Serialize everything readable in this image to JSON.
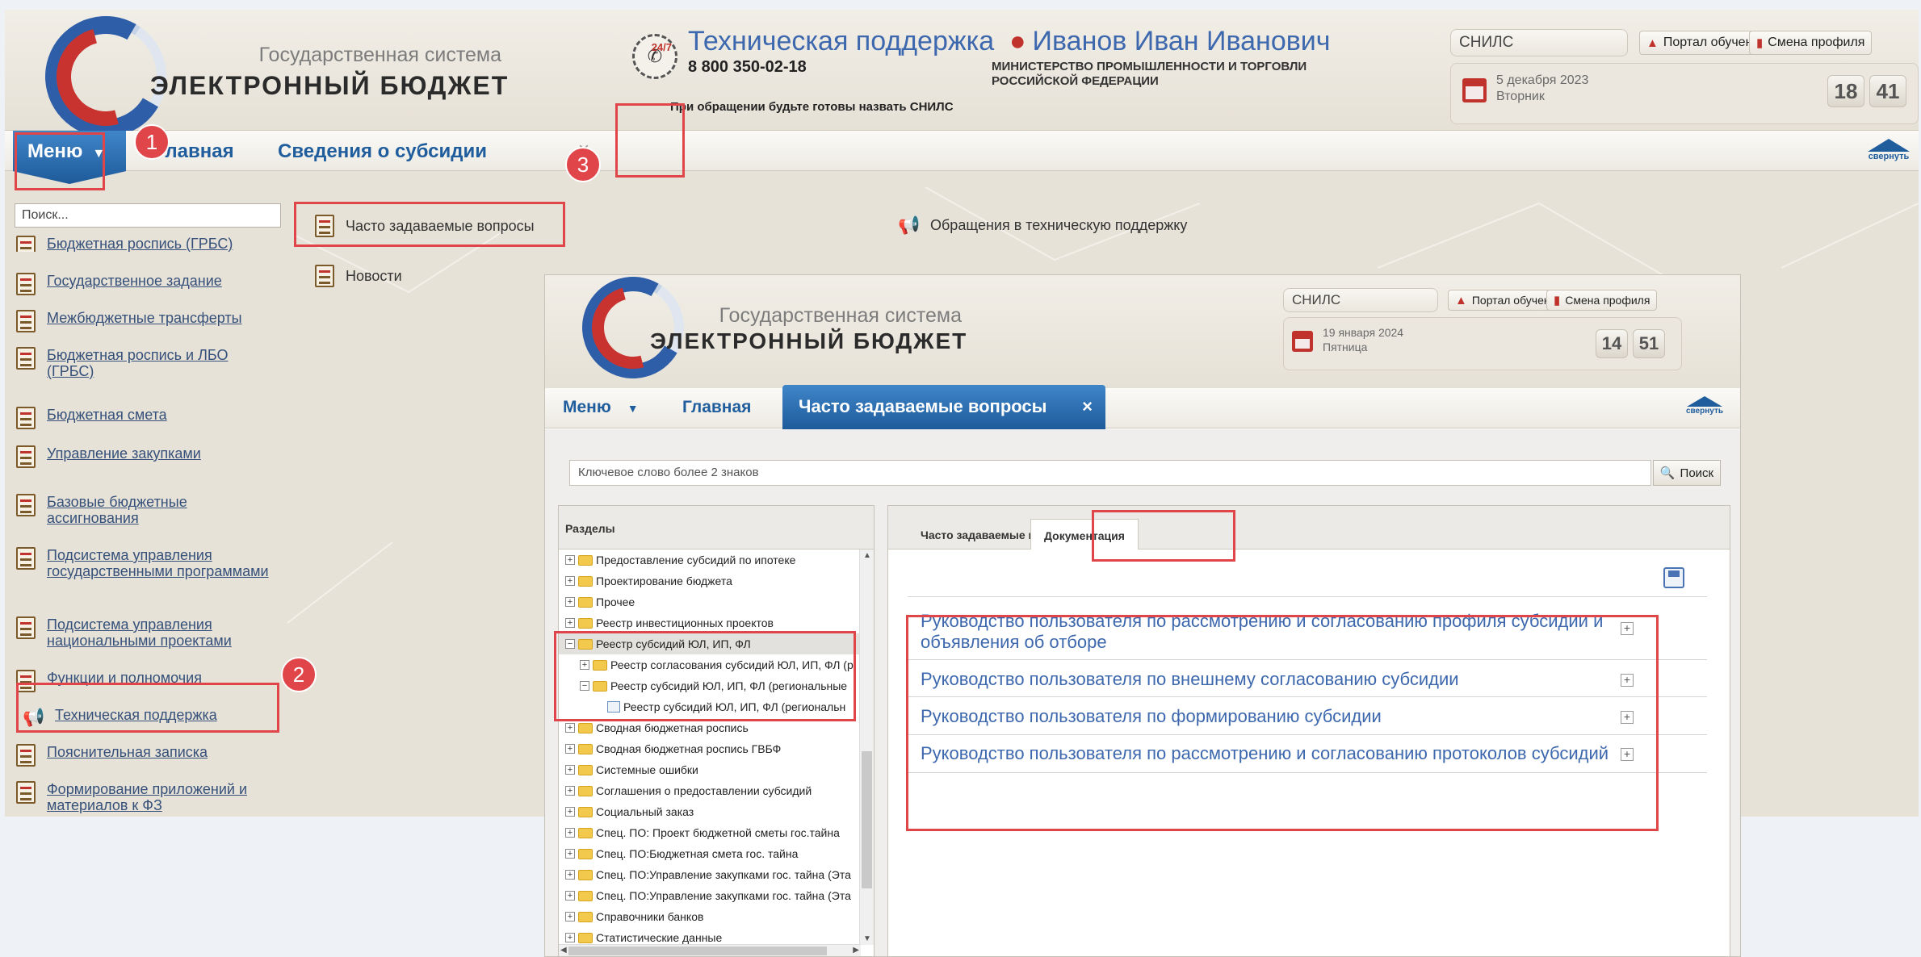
{
  "app": {
    "title_small": "Государственная система",
    "title_big": "ЭЛЕКТРОННЫЙ БЮДЖЕТ"
  },
  "support": {
    "icon_badge": "24/7",
    "title": "Техническая поддержка",
    "phone": "8 800 350-02-18",
    "note": "При обращении будьте готовы назвать СНИЛС"
  },
  "user": {
    "name": "Иванов Иван Иванович",
    "org": "МИНИСТЕРСТВО ПРОМЫШЛЕННОСТИ И ТОРГОВЛИ РОССИЙСКОЙ ФЕДЕРАЦИИ"
  },
  "header_right": {
    "snils": "СНИЛС",
    "portal_btn": "Портал обучения",
    "profile_btn": "Смена профиля",
    "date_line1": "5 декабря 2023",
    "date_line2": "Вторник",
    "clock_h": "18",
    "clock_m": "41"
  },
  "nav": {
    "menu": "Меню",
    "home": "Главная",
    "tab_subsidy": "Сведения о субсидии",
    "close": "×",
    "collapse": "свернуть"
  },
  "left_menu": {
    "search_placeholder": "Поиск...",
    "items": [
      "Бюджетная роспись (ГРБС)",
      "Государственное задание",
      "Межбюджетные трансферты",
      "Бюджетная роспись и ЛБО (ГРБС)",
      "Бюджетная смета",
      "Управление закупками",
      "Базовые бюджетные ассигнования",
      "Подсистема управления государственными программами",
      "Подсистема управления национальными проектами",
      "Функции и полномочия",
      "Техническая поддержка",
      "Пояснительная записка",
      "Формирование приложений и материалов к ФЗ"
    ]
  },
  "submenu": {
    "faq": "Часто задаваемые вопросы",
    "news": "Новости",
    "tech_requests": "Обращения в техническую поддержку"
  },
  "window": {
    "snils": "СНИЛС",
    "portal_btn": "Портал обучения",
    "profile_btn": "Смена профиля",
    "date_line1": "19 января 2024",
    "date_line2": "Пятница",
    "clock_h": "14",
    "clock_m": "51",
    "nav_menu": "Меню",
    "nav_home": "Главная",
    "active_tab": "Часто задаваемые вопросы",
    "tab_close": "×",
    "collapse": "свернуть",
    "search_placeholder": "Ключевое слово более 2 знаков",
    "search_btn": "Поиск",
    "sections_title": "Разделы",
    "tree": [
      {
        "label": "Предоставление субсидий по ипотеке",
        "level": 0,
        "exp": "+",
        "type": "folder"
      },
      {
        "label": "Проектирование бюджета",
        "level": 0,
        "exp": "+",
        "type": "folder"
      },
      {
        "label": "Прочее",
        "level": 0,
        "exp": "+",
        "type": "folder"
      },
      {
        "label": "Реестр инвестиционных проектов",
        "level": 0,
        "exp": "+",
        "type": "folder"
      },
      {
        "label": "Реестр субсидий ЮЛ, ИП, ФЛ",
        "level": 0,
        "exp": "−",
        "type": "folder",
        "selected": true
      },
      {
        "label": "Реестр согласования субсидий ЮЛ, ИП, ФЛ (р",
        "level": 1,
        "exp": "+",
        "type": "folder"
      },
      {
        "label": "Реестр субсидий ЮЛ, ИП, ФЛ (региональные",
        "level": 1,
        "exp": "−",
        "type": "folder"
      },
      {
        "label": "Реестр субсидий ЮЛ, ИП, ФЛ (региональн",
        "level": 2,
        "exp": "",
        "type": "leaf"
      },
      {
        "label": "Сводная бюджетная роспись",
        "level": 0,
        "exp": "+",
        "type": "folder"
      },
      {
        "label": "Сводная бюджетная роспись ГВБФ",
        "level": 0,
        "exp": "+",
        "type": "folder"
      },
      {
        "label": "Системные ошибки",
        "level": 0,
        "exp": "+",
        "type": "folder"
      },
      {
        "label": "Соглашения о предоставлении субсидий",
        "level": 0,
        "exp": "+",
        "type": "folder"
      },
      {
        "label": "Социальный заказ",
        "level": 0,
        "exp": "+",
        "type": "folder"
      },
      {
        "label": "Спец. ПО: Проект бюджетной сметы гос.тайна",
        "level": 0,
        "exp": "+",
        "type": "folder"
      },
      {
        "label": "Спец. ПО:Бюджетная смета гос. тайна",
        "level": 0,
        "exp": "+",
        "type": "folder"
      },
      {
        "label": "Спец. ПО:Управление закупками гос. тайна (Эта",
        "level": 0,
        "exp": "+",
        "type": "folder"
      },
      {
        "label": "Спец. ПО:Управление закупками гос. тайна (Эта",
        "level": 0,
        "exp": "+",
        "type": "folder"
      },
      {
        "label": "Справочники банков",
        "level": 0,
        "exp": "+",
        "type": "folder"
      },
      {
        "label": "Статистические данные",
        "level": 0,
        "exp": "+",
        "type": "folder"
      }
    ],
    "tab_faq": "Часто задаваемые вопросы",
    "tab_docs": "Документация",
    "docs": [
      "Руководство пользователя по рассмотрению и согласованию профиля субсидии и объявления об отборе",
      "Руководство пользователя по внешнему согласованию субсидии",
      "Руководство пользователя по формированию субсидии",
      "Руководство пользователя по рассмотрению и согласованию протоколов субсидий"
    ]
  },
  "badges": [
    "1",
    "2",
    "3"
  ],
  "colors": {
    "accent": "#1f5d9d",
    "highlight": "#e0454a",
    "brand_red": "#c0332d"
  }
}
